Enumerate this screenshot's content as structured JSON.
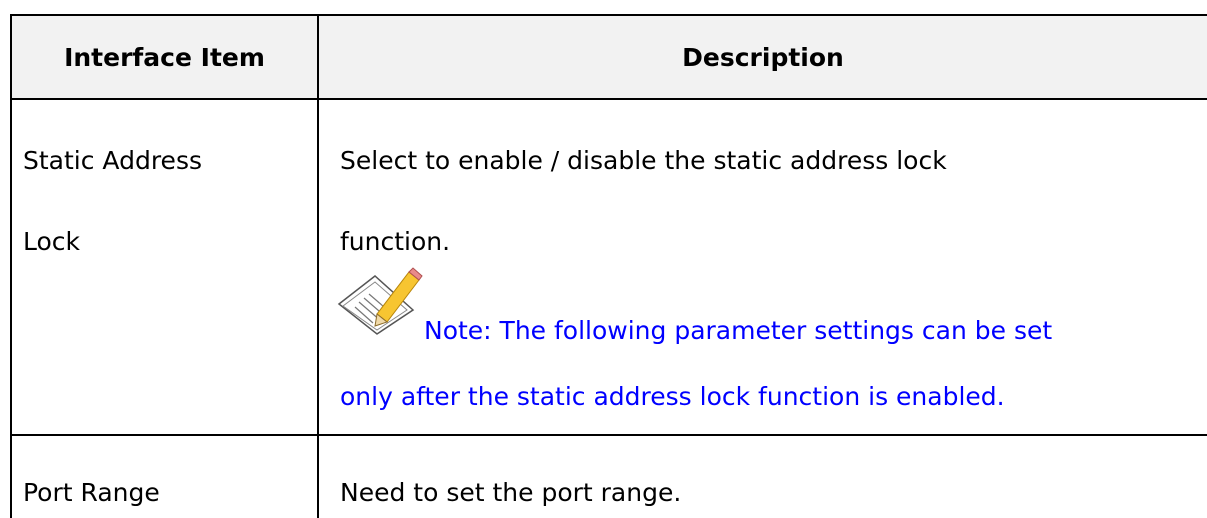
{
  "table": {
    "headers": [
      "Interface Item",
      "Description"
    ],
    "rows": [
      {
        "item_line1": "Static Address",
        "item_line2": "Lock",
        "desc_line1": "Select to enable / disable the static address lock",
        "desc_line2": "function.",
        "note_line1": "Note: The following parameter settings can be set",
        "note_line2": "only after the static address lock function is enabled.",
        "note_icon": "note-pencil-icon"
      },
      {
        "item": "Port Range",
        "desc": "Need to set the port range."
      }
    ]
  },
  "colors": {
    "header_bg": "#f2f2f2",
    "note": "#0000ff",
    "text": "#000000"
  }
}
